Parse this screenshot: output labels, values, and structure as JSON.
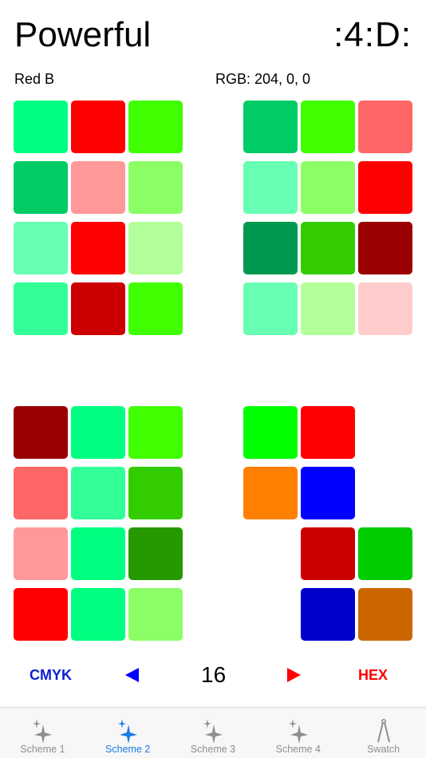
{
  "header": {
    "title": "Powerful",
    "logo": ":4:D:"
  },
  "info": {
    "color_name": "Red B",
    "rgb_text": "RGB: 204, 0, 0"
  },
  "grids": [
    {
      "name": "swatch-grid-top-left",
      "colors": [
        "#00ff80",
        "#ff0000",
        "#40ff00",
        "#00cc66",
        "#ff9999",
        "#8cff66",
        "#66ffb3",
        "#ff0000",
        "#b3ff99",
        "#33ff99",
        "#cc0000",
        "#40ff00"
      ]
    },
    {
      "name": "swatch-grid-top-right",
      "colors": [
        "#00cc66",
        "#40ff00",
        "#ff6666",
        "#66ffb3",
        "#8cff66",
        "#ff0000",
        "#009950",
        "#33cc00",
        "#990000",
        "#66ffb3",
        "#b3ff99",
        "#ffcccc"
      ]
    },
    {
      "name": "swatch-grid-bottom-left",
      "colors": [
        "#990000",
        "#00ff80",
        "#40ff00",
        "#ff6666",
        "#33ff99",
        "#33cc00",
        "#ff9999",
        "#00ff80",
        "#269900",
        "#ff0000",
        "#00ff80",
        "#8cff66"
      ]
    },
    {
      "name": "swatch-grid-bottom-right",
      "colors": [
        "#00ff00",
        "#ff0000",
        "",
        "#ff8000",
        "#0000ff",
        "",
        "",
        "#cc0000",
        "#00cc00",
        "",
        "#0000cc",
        "#cc6600"
      ]
    }
  ],
  "controls": {
    "left_label": "CMYK",
    "count": "16",
    "right_label": "HEX"
  },
  "tabbar": {
    "tabs": [
      {
        "label": "Scheme 1",
        "icon": "sparkle-icon",
        "active": false
      },
      {
        "label": "Scheme 2",
        "icon": "sparkle-icon",
        "active": true
      },
      {
        "label": "Scheme 3",
        "icon": "sparkle-icon",
        "active": false
      },
      {
        "label": "Scheme 4",
        "icon": "sparkle-icon",
        "active": false
      },
      {
        "label": "Swatch",
        "icon": "compass-icon",
        "active": false
      }
    ],
    "active_color": "#1a7ae6",
    "inactive_color": "#8e8e93"
  }
}
